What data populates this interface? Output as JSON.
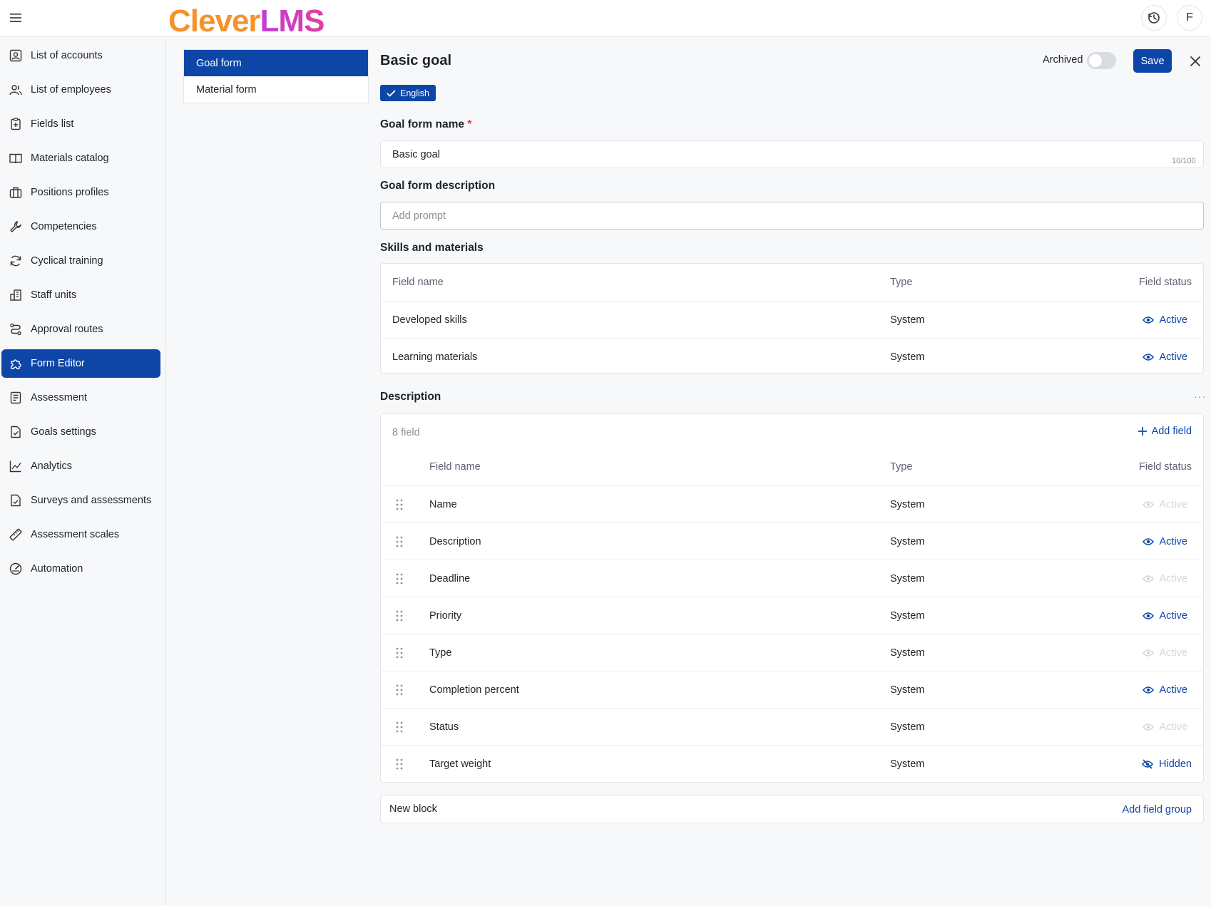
{
  "header": {
    "logo_part1": "Clever",
    "logo_part2": "LMS",
    "avatar_initial": "F"
  },
  "sidebar": {
    "items": [
      {
        "label": "List of accounts",
        "icon": "account-box-icon"
      },
      {
        "label": "List of employees",
        "icon": "people-icon"
      },
      {
        "label": "Fields list",
        "icon": "clipboard-plus-icon"
      },
      {
        "label": "Materials catalog",
        "icon": "book-icon"
      },
      {
        "label": "Positions profiles",
        "icon": "briefcase-icon"
      },
      {
        "label": "Competencies",
        "icon": "wrench-icon"
      },
      {
        "label": "Cyclical training",
        "icon": "refresh-icon"
      },
      {
        "label": "Staff units",
        "icon": "building-icon"
      },
      {
        "label": "Approval routes",
        "icon": "route-icon"
      },
      {
        "label": "Form Editor",
        "icon": "puzzle-icon",
        "active": true
      },
      {
        "label": "Assessment",
        "icon": "list-doc-icon"
      },
      {
        "label": "Goals settings",
        "icon": "doc-check-icon"
      },
      {
        "label": "Analytics",
        "icon": "line-chart-icon"
      },
      {
        "label": "Surveys and assessments",
        "icon": "doc-survey-icon"
      },
      {
        "label": "Assessment scales",
        "icon": "ruler-icon"
      },
      {
        "label": "Automation",
        "icon": "gauge-icon"
      }
    ]
  },
  "forms": {
    "items": [
      {
        "label": "Goal form",
        "active": true
      },
      {
        "label": "Material form"
      }
    ]
  },
  "main": {
    "title": "Basic goal",
    "archived_label": "Archived",
    "archived": false,
    "save_label": "Save",
    "language": "English",
    "name_label": "Goal form name",
    "name_required_mark": "*",
    "name_value": "Basic goal",
    "name_counter": "10/100",
    "description_label": "Goal form description",
    "description_placeholder": "Add prompt"
  },
  "skills": {
    "title": "Skills and materials",
    "columns": {
      "name": "Field name",
      "type": "Type",
      "status": "Field status"
    },
    "rows": [
      {
        "name": "Developed skills",
        "type": "System",
        "status": "Active"
      },
      {
        "name": "Learning materials",
        "type": "System",
        "status": "Active"
      }
    ]
  },
  "description_block": {
    "title": "Description",
    "more": "···",
    "field_count": "8 field",
    "add_field_label": "Add field",
    "columns": {
      "name": "Field name",
      "type": "Type",
      "status": "Field status"
    },
    "rows": [
      {
        "name": "Name",
        "type": "System",
        "status": "Active",
        "state": "disabled"
      },
      {
        "name": "Description",
        "type": "System",
        "status": "Active",
        "state": "active"
      },
      {
        "name": "Deadline",
        "type": "System",
        "status": "Active",
        "state": "disabled"
      },
      {
        "name": "Priority",
        "type": "System",
        "status": "Active",
        "state": "active"
      },
      {
        "name": "Type",
        "type": "System",
        "status": "Active",
        "state": "disabled"
      },
      {
        "name": "Completion percent",
        "type": "System",
        "status": "Active",
        "state": "active"
      },
      {
        "name": "Status",
        "type": "System",
        "status": "Active",
        "state": "disabled"
      },
      {
        "name": "Target weight",
        "type": "System",
        "status": "Hidden",
        "state": "hidden"
      }
    ]
  },
  "new_block": {
    "label": "New block",
    "add_group_label": "Add field group"
  },
  "colors": {
    "primary": "#0e46a8",
    "logo_orange": "#f5922a",
    "logo_magenta": "#c13fd6",
    "disabled": "#d4d8dd",
    "required": "#e03c3c"
  }
}
